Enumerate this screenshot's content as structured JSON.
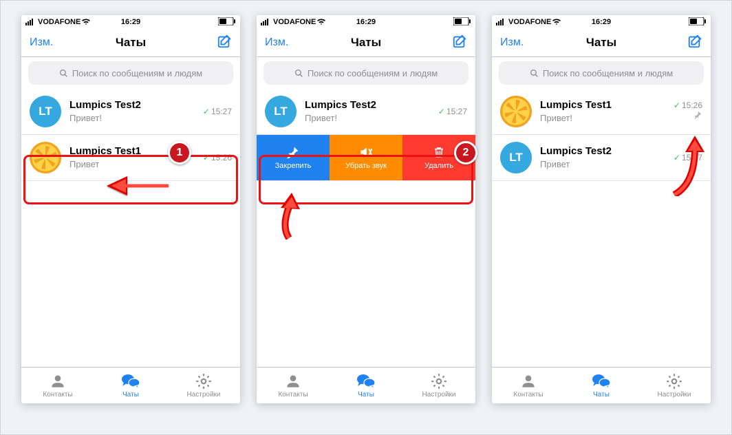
{
  "status": {
    "carrier": "VODAFONE",
    "time": "16:29"
  },
  "nav": {
    "edit": "Изм.",
    "title": "Чаты"
  },
  "search": {
    "placeholder": "Поиск по сообщениям и людям"
  },
  "s1": {
    "r1": {
      "name": "Lumpics Test2",
      "msg": "Привет!",
      "time": "15:27",
      "init": "LT"
    },
    "r2": {
      "name": "Lumpics Test1",
      "msg": "Привет",
      "time": "15:26"
    }
  },
  "s2": {
    "r1": {
      "name": "Lumpics Test2",
      "msg": "Привет!",
      "time": "15:27",
      "init": "LT"
    },
    "act": {
      "pin": "Закрепить",
      "mute": "Убрать звук",
      "del": "Удалить"
    }
  },
  "s3": {
    "r1": {
      "name": "Lumpics Test1",
      "msg": "Привет!",
      "time": "15:26"
    },
    "r2": {
      "name": "Lumpics Test2",
      "msg": "Привет",
      "time": "15:27",
      "init": "LT"
    }
  },
  "tabs": {
    "contacts": "Контакты",
    "chats": "Чаты",
    "settings": "Настройки"
  },
  "badges": {
    "one": "1",
    "two": "2"
  }
}
